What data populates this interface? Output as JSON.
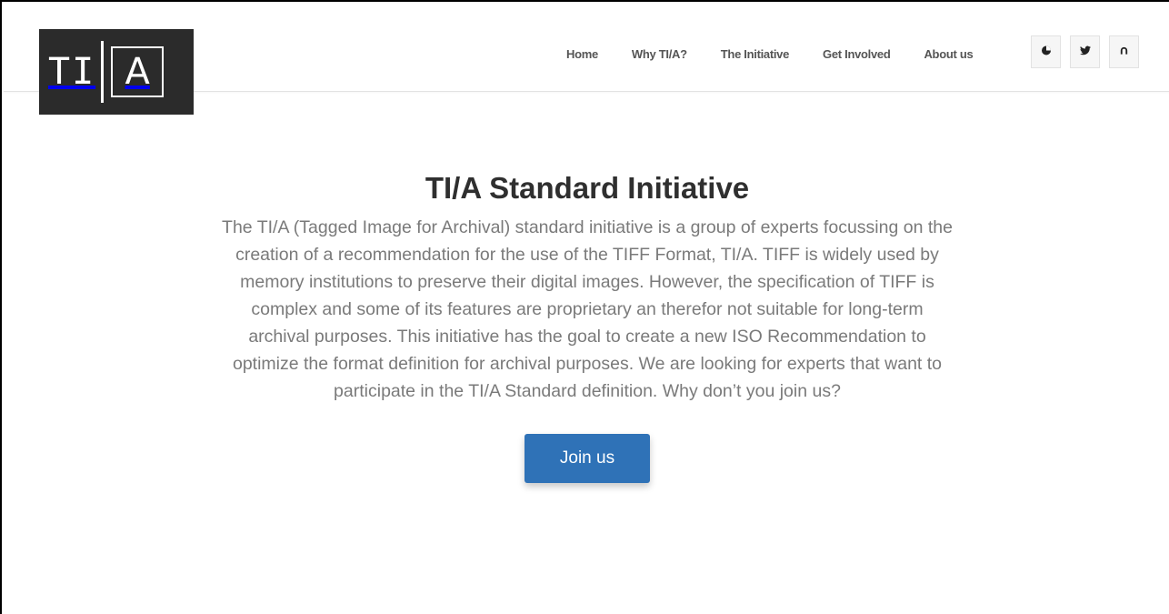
{
  "logo": {
    "left_text": "TI",
    "right_text": "A"
  },
  "nav": {
    "items": [
      {
        "label": "Home"
      },
      {
        "label": "Why TI/A?"
      },
      {
        "label": "The Initiative"
      },
      {
        "label": "Get Involved"
      },
      {
        "label": "About us"
      }
    ]
  },
  "social": {
    "icons": [
      "blog-icon",
      "twitter-icon",
      "github-icon"
    ]
  },
  "hero": {
    "title": "TI/A Standard Initiative",
    "description": "The TI/A (Tagged Image for Archival) standard initiative is a group of experts focussing on the creation of a recommendation for the use of the TIFF Format, TI/A. TIFF is widely used by memory institutions to preserve their digital images. However, the specification of TIFF is complex and some of its features are proprietary an therefor not suitable for long-term archival purposes. This initiative has the goal to create a new ISO Recommendation to optimize the format definition for archival purposes. We are looking for experts that want to participate in the TI/A Standard definition. Why don’t you join us?",
    "button_label": "Join us"
  },
  "colors": {
    "logo_bg": "#2b2b2b",
    "button_bg": "#2f72b7",
    "title": "#2f2f2f",
    "body_text": "#7a7a7a",
    "nav_text": "#555555"
  }
}
